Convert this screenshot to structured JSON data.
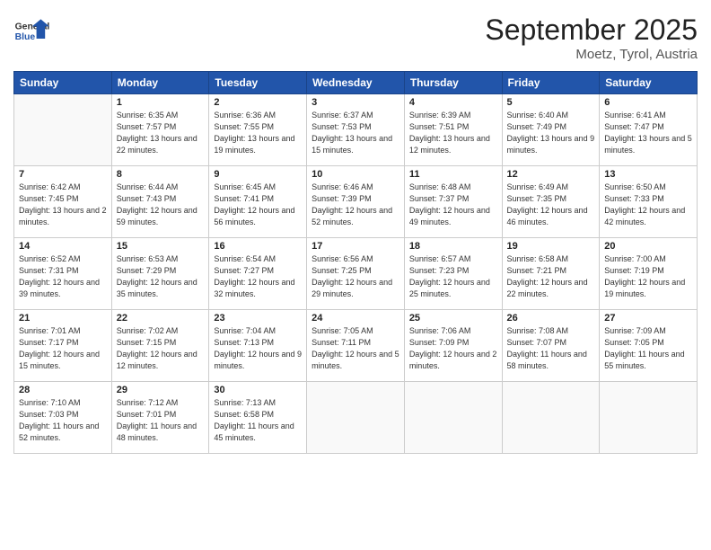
{
  "header": {
    "logo_general": "General",
    "logo_blue": "Blue",
    "month_title": "September 2025",
    "location": "Moetz, Tyrol, Austria"
  },
  "weekdays": [
    "Sunday",
    "Monday",
    "Tuesday",
    "Wednesday",
    "Thursday",
    "Friday",
    "Saturday"
  ],
  "weeks": [
    [
      {
        "day": "",
        "sunrise": "",
        "sunset": "",
        "daylight": ""
      },
      {
        "day": "1",
        "sunrise": "Sunrise: 6:35 AM",
        "sunset": "Sunset: 7:57 PM",
        "daylight": "Daylight: 13 hours and 22 minutes."
      },
      {
        "day": "2",
        "sunrise": "Sunrise: 6:36 AM",
        "sunset": "Sunset: 7:55 PM",
        "daylight": "Daylight: 13 hours and 19 minutes."
      },
      {
        "day": "3",
        "sunrise": "Sunrise: 6:37 AM",
        "sunset": "Sunset: 7:53 PM",
        "daylight": "Daylight: 13 hours and 15 minutes."
      },
      {
        "day": "4",
        "sunrise": "Sunrise: 6:39 AM",
        "sunset": "Sunset: 7:51 PM",
        "daylight": "Daylight: 13 hours and 12 minutes."
      },
      {
        "day": "5",
        "sunrise": "Sunrise: 6:40 AM",
        "sunset": "Sunset: 7:49 PM",
        "daylight": "Daylight: 13 hours and 9 minutes."
      },
      {
        "day": "6",
        "sunrise": "Sunrise: 6:41 AM",
        "sunset": "Sunset: 7:47 PM",
        "daylight": "Daylight: 13 hours and 5 minutes."
      }
    ],
    [
      {
        "day": "7",
        "sunrise": "Sunrise: 6:42 AM",
        "sunset": "Sunset: 7:45 PM",
        "daylight": "Daylight: 13 hours and 2 minutes."
      },
      {
        "day": "8",
        "sunrise": "Sunrise: 6:44 AM",
        "sunset": "Sunset: 7:43 PM",
        "daylight": "Daylight: 12 hours and 59 minutes."
      },
      {
        "day": "9",
        "sunrise": "Sunrise: 6:45 AM",
        "sunset": "Sunset: 7:41 PM",
        "daylight": "Daylight: 12 hours and 56 minutes."
      },
      {
        "day": "10",
        "sunrise": "Sunrise: 6:46 AM",
        "sunset": "Sunset: 7:39 PM",
        "daylight": "Daylight: 12 hours and 52 minutes."
      },
      {
        "day": "11",
        "sunrise": "Sunrise: 6:48 AM",
        "sunset": "Sunset: 7:37 PM",
        "daylight": "Daylight: 12 hours and 49 minutes."
      },
      {
        "day": "12",
        "sunrise": "Sunrise: 6:49 AM",
        "sunset": "Sunset: 7:35 PM",
        "daylight": "Daylight: 12 hours and 46 minutes."
      },
      {
        "day": "13",
        "sunrise": "Sunrise: 6:50 AM",
        "sunset": "Sunset: 7:33 PM",
        "daylight": "Daylight: 12 hours and 42 minutes."
      }
    ],
    [
      {
        "day": "14",
        "sunrise": "Sunrise: 6:52 AM",
        "sunset": "Sunset: 7:31 PM",
        "daylight": "Daylight: 12 hours and 39 minutes."
      },
      {
        "day": "15",
        "sunrise": "Sunrise: 6:53 AM",
        "sunset": "Sunset: 7:29 PM",
        "daylight": "Daylight: 12 hours and 35 minutes."
      },
      {
        "day": "16",
        "sunrise": "Sunrise: 6:54 AM",
        "sunset": "Sunset: 7:27 PM",
        "daylight": "Daylight: 12 hours and 32 minutes."
      },
      {
        "day": "17",
        "sunrise": "Sunrise: 6:56 AM",
        "sunset": "Sunset: 7:25 PM",
        "daylight": "Daylight: 12 hours and 29 minutes."
      },
      {
        "day": "18",
        "sunrise": "Sunrise: 6:57 AM",
        "sunset": "Sunset: 7:23 PM",
        "daylight": "Daylight: 12 hours and 25 minutes."
      },
      {
        "day": "19",
        "sunrise": "Sunrise: 6:58 AM",
        "sunset": "Sunset: 7:21 PM",
        "daylight": "Daylight: 12 hours and 22 minutes."
      },
      {
        "day": "20",
        "sunrise": "Sunrise: 7:00 AM",
        "sunset": "Sunset: 7:19 PM",
        "daylight": "Daylight: 12 hours and 19 minutes."
      }
    ],
    [
      {
        "day": "21",
        "sunrise": "Sunrise: 7:01 AM",
        "sunset": "Sunset: 7:17 PM",
        "daylight": "Daylight: 12 hours and 15 minutes."
      },
      {
        "day": "22",
        "sunrise": "Sunrise: 7:02 AM",
        "sunset": "Sunset: 7:15 PM",
        "daylight": "Daylight: 12 hours and 12 minutes."
      },
      {
        "day": "23",
        "sunrise": "Sunrise: 7:04 AM",
        "sunset": "Sunset: 7:13 PM",
        "daylight": "Daylight: 12 hours and 9 minutes."
      },
      {
        "day": "24",
        "sunrise": "Sunrise: 7:05 AM",
        "sunset": "Sunset: 7:11 PM",
        "daylight": "Daylight: 12 hours and 5 minutes."
      },
      {
        "day": "25",
        "sunrise": "Sunrise: 7:06 AM",
        "sunset": "Sunset: 7:09 PM",
        "daylight": "Daylight: 12 hours and 2 minutes."
      },
      {
        "day": "26",
        "sunrise": "Sunrise: 7:08 AM",
        "sunset": "Sunset: 7:07 PM",
        "daylight": "Daylight: 11 hours and 58 minutes."
      },
      {
        "day": "27",
        "sunrise": "Sunrise: 7:09 AM",
        "sunset": "Sunset: 7:05 PM",
        "daylight": "Daylight: 11 hours and 55 minutes."
      }
    ],
    [
      {
        "day": "28",
        "sunrise": "Sunrise: 7:10 AM",
        "sunset": "Sunset: 7:03 PM",
        "daylight": "Daylight: 11 hours and 52 minutes."
      },
      {
        "day": "29",
        "sunrise": "Sunrise: 7:12 AM",
        "sunset": "Sunset: 7:01 PM",
        "daylight": "Daylight: 11 hours and 48 minutes."
      },
      {
        "day": "30",
        "sunrise": "Sunrise: 7:13 AM",
        "sunset": "Sunset: 6:58 PM",
        "daylight": "Daylight: 11 hours and 45 minutes."
      },
      {
        "day": "",
        "sunrise": "",
        "sunset": "",
        "daylight": ""
      },
      {
        "day": "",
        "sunrise": "",
        "sunset": "",
        "daylight": ""
      },
      {
        "day": "",
        "sunrise": "",
        "sunset": "",
        "daylight": ""
      },
      {
        "day": "",
        "sunrise": "",
        "sunset": "",
        "daylight": ""
      }
    ]
  ]
}
